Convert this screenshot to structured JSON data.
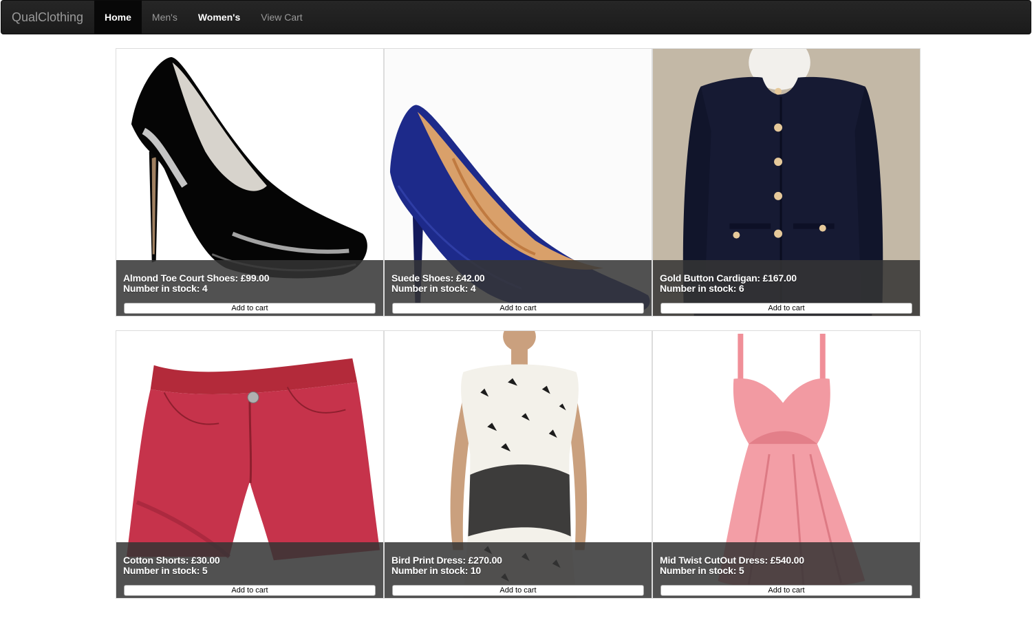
{
  "navbar": {
    "brand": "QualClothing",
    "items": [
      {
        "label": "Home",
        "active": true
      },
      {
        "label": "Men's",
        "active": false
      },
      {
        "label": "Women's",
        "active": false
      },
      {
        "label": "View Cart",
        "active": false
      }
    ]
  },
  "products": [
    {
      "title": "Almond Toe Court Shoes: £99.00",
      "stock": "Number in stock: 4",
      "button": "Add to cart",
      "image": "black-patent-court-shoe"
    },
    {
      "title": "Suede Shoes: £42.00",
      "stock": "Number in stock: 4",
      "button": "Add to cart",
      "image": "navy-suede-pump"
    },
    {
      "title": "Gold Button Cardigan: £167.00",
      "stock": "Number in stock: 6",
      "button": "Add to cart",
      "image": "navy-gold-button-cardigan"
    },
    {
      "title": "Cotton Shorts: £30.00",
      "stock": "Number in stock: 5",
      "button": "Add to cart",
      "image": "red-cotton-shorts"
    },
    {
      "title": "Bird Print Dress: £270.00",
      "stock": "Number in stock: 10",
      "button": "Add to cart",
      "image": "bird-print-dress-model"
    },
    {
      "title": "Mid Twist CutOut Dress: £540.00",
      "stock": "Number in stock: 5",
      "button": "Add to cart",
      "image": "pink-cutout-dress"
    }
  ],
  "colors": {
    "navbar_bg": "#222222",
    "navbar_active": "#080808",
    "caption_bg": "#343434"
  }
}
